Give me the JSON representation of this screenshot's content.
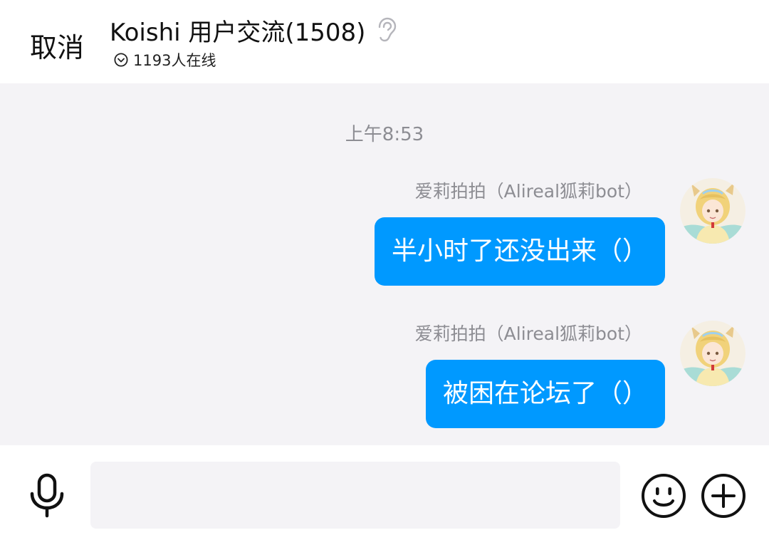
{
  "header": {
    "cancel_label": "取消",
    "title": "Koishi 用户交流(1508)",
    "online_text": "1193人在线"
  },
  "chat": {
    "timestamp": "上午8:53",
    "messages": [
      {
        "sender": "爱莉拍拍（Alireal狐莉bot）",
        "text": "半小时了还没出来（）"
      },
      {
        "sender": "爱莉拍拍（Alireal狐莉bot）",
        "text": "被困在论坛了（）"
      }
    ]
  },
  "composer": {
    "input_value": ""
  },
  "icons": {
    "ear": "ear-icon",
    "online": "chevron-circle-icon",
    "mic": "microphone-icon",
    "emoji": "smiley-icon",
    "plus": "plus-circle-icon"
  },
  "colors": {
    "bubble": "#0099ff",
    "chat_bg": "#f4f3f6",
    "meta_text": "#8d8d93"
  }
}
